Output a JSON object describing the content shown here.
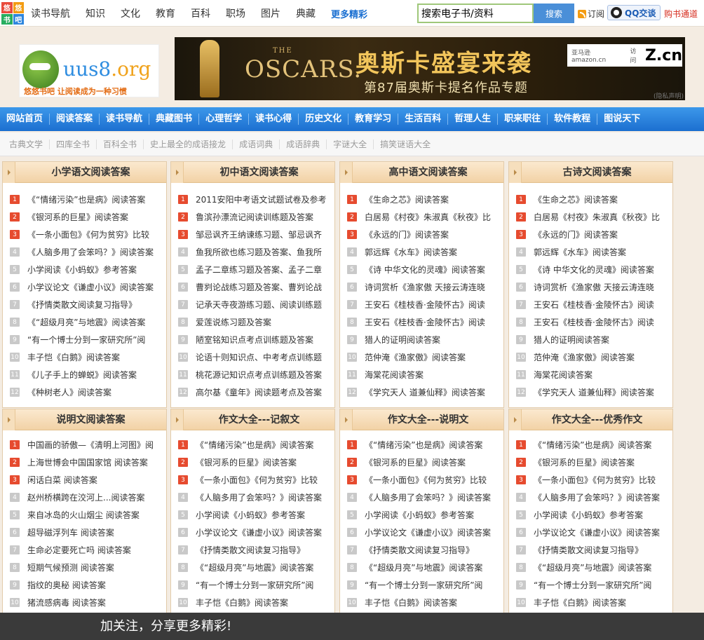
{
  "topbar": {
    "logo_chars": [
      "悠",
      "悠",
      "书",
      "吧"
    ],
    "nav": [
      "读书导航",
      "知识",
      "文化",
      "教育",
      "百科",
      "职场",
      "图片",
      "典藏"
    ],
    "more": "更多精彩",
    "search_value": "搜索电子书/资料",
    "search_button": "搜索",
    "rss": "订阅",
    "qq": "QQ交谈",
    "buy": "购书通道"
  },
  "site_logo": {
    "brand_a": "uus8",
    "brand_b": ".org",
    "slogan": "悠悠书吧 让阅读成为一种习惯"
  },
  "promo": {
    "the": "THE",
    "oscars": "OSCARS.",
    "headline": "奥斯卡盛宴来袭",
    "sub": "第87届奥斯卡提名作品专题",
    "partner_amazon": "亚马逊 amazon.cn",
    "partner_visit": "访问",
    "partner_zcn": "Z.cn",
    "privacy": "(隐私声明)"
  },
  "mainnav": [
    "网站首页",
    "阅读答案",
    "读书导航",
    "典藏图书",
    "心理哲学",
    "读书心得",
    "历史文化",
    "教育学习",
    "生活百科",
    "哲理人生",
    "职来职往",
    "软件教程",
    "图说天下"
  ],
  "subnav": [
    "古典文学",
    "四库全书",
    "百科全书",
    "史上最全的成语接龙",
    "成语词典",
    "成语辞典",
    "字谜大全",
    "搞笑谜语大全"
  ],
  "boxes": [
    {
      "title": "小学语文阅读答案",
      "items": [
        "《“情绪污染”也是病》阅读答案",
        "《银河系的巨星》阅读答案",
        "《一条小面包》《何为贫穷》比较",
        "《人脑多用了会笨吗？》阅读答案",
        "小学阅读《小蚂蚁》参考答案",
        "小学议论文《谦虚小议》阅读答案",
        "《抒情类散文阅读复习指导》",
        "《“超级月亮”与地震》阅读答案",
        "“有一个博士分到一家研究所”阅",
        "丰子恺《白鹅》阅读答案",
        "《儿子手上的蝉蜕》阅读答案",
        "《种树老人》阅读答案"
      ]
    },
    {
      "title": "初中语文阅读答案",
      "items": [
        "2011安阳中考语文试题试卷及参考",
        "鲁滨孙漂流记阅读训练题及答案",
        "邹忌讽齐王纳谏练习题、邹忌讽齐",
        "鱼我所欲也练习题及答案、鱼我所",
        "孟子二章练习题及答案、孟子二章",
        "曹刿论战练习题及答案、曹刿论战",
        "记承天寺夜游练习题、阅读训练题",
        "爱莲说练习题及答案",
        "陋室铭知识点考点训练题及答案",
        "论语十则知识点、中考考点训练题",
        "桃花源记知识点考点训练题及答案",
        "高尔基《童年》阅读题考点及答案"
      ]
    },
    {
      "title": "高中语文阅读答案",
      "items": [
        "《生命之芯》阅读答案",
        "白居易《村夜》朱淑真《秋夜》比",
        "《永远的门》阅读答案",
        "郭远辉《水车》阅读答案",
        "《诗 中华文化的灵魂》阅读答案",
        "诗词赏析《渔家傲 天接云涛连晓",
        "王安石《桂枝香·金陵怀古》阅读",
        "王安石《桂枝香·金陵怀古》阅读",
        "猎人的证明阅读答案",
        "范仲淹《渔家傲》阅读答案",
        "海棠花阅读答案",
        "《学究天人 道兼仙释》阅读答案"
      ]
    },
    {
      "title": "古诗文阅读答案",
      "items": [
        "《生命之芯》阅读答案",
        "白居易《村夜》朱淑真《秋夜》比",
        "《永远的门》阅读答案",
        "郭远辉《水车》阅读答案",
        "《诗 中华文化的灵魂》阅读答案",
        "诗词赏析《渔家傲 天接云涛连晓",
        "王安石《桂枝香·金陵怀古》阅读",
        "王安石《桂枝香·金陵怀古》阅读",
        "猎人的证明阅读答案",
        "范仲淹《渔家傲》阅读答案",
        "海棠花阅读答案",
        "《学究天人 道兼仙释》阅读答案"
      ]
    },
    {
      "title": "说明文阅读答案",
      "items": [
        "中国画的骄傲—《清明上河图》阅",
        "上海世博会中国国家馆 阅读答案",
        "闲话白菜 阅读答案",
        "赵州桥横跨在洨河上...阅读答案",
        "来自冰岛的火山烟尘 阅读答案",
        "超导磁浮列车 阅读答案",
        "生命必定要死亡吗 阅读答案",
        "短期气候预测 阅读答案",
        "指纹的奥秘 阅读答案",
        "猪流感病毒 阅读答案"
      ]
    },
    {
      "title": "作文大全---记叙文",
      "items": [
        "《“情绪污染”也是病》阅读答案",
        "《银河系的巨星》阅读答案",
        "《一条小面包》《何为贫穷》比较",
        "《人脑多用了会笨吗？》阅读答案",
        "小学阅读《小蚂蚁》参考答案",
        "小学议论文《谦虚小议》阅读答案",
        "《抒情类散文阅读复习指导》",
        "《“超级月亮”与地震》阅读答案",
        "“有一个博士分到一家研究所”阅",
        "丰子恺《白鹅》阅读答案"
      ]
    },
    {
      "title": "作文大全---说明文",
      "items": [
        "《“情绪污染”也是病》阅读答案",
        "《银河系的巨星》阅读答案",
        "《一条小面包》《何为贫穷》比较",
        "《人脑多用了会笨吗？》阅读答案",
        "小学阅读《小蚂蚁》参考答案",
        "小学议论文《谦虚小议》阅读答案",
        "《抒情类散文阅读复习指导》",
        "《“超级月亮”与地震》阅读答案",
        "“有一个博士分到一家研究所”阅",
        "丰子恺《白鹅》阅读答案"
      ]
    },
    {
      "title": "作文大全---优秀作文",
      "items": [
        "《“情绪污染”也是病》阅读答案",
        "《银河系的巨星》阅读答案",
        "《一条小面包》《何为贫穷》比较",
        "《人脑多用了会笨吗？》阅读答案",
        "小学阅读《小蚂蚁》参考答案",
        "小学议论文《谦虚小议》阅读答案",
        "《抒情类散文阅读复习指导》",
        "《“超级月亮”与地震》阅读答案",
        "“有一个博士分到一家研究所”阅",
        "丰子恺《白鹅》阅读答案"
      ]
    }
  ],
  "footer": "加关注，分享更多精彩!"
}
